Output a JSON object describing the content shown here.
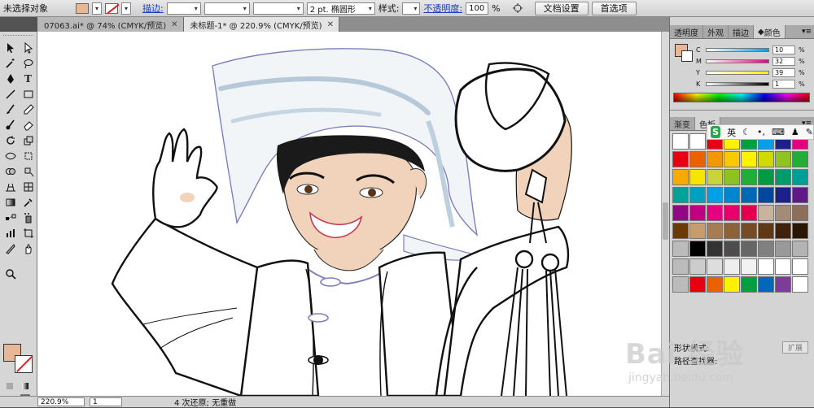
{
  "controlbar": {
    "selection_label": "未选择对象",
    "stroke_label": "描边:",
    "brush_label": "2 pt. 椭圆形",
    "style_label": "样式:",
    "opacity_label": "不透明度:",
    "opacity_value": "100",
    "opacity_unit": "%",
    "doc_setup_button": "文档设置",
    "prefs_button": "首选项"
  },
  "tabs": [
    {
      "label": "07063.ai* @ 74% (CMYK/预览)"
    },
    {
      "label": "未标题-1* @ 220.9% (CMYK/预览)"
    }
  ],
  "status": {
    "zoom": "220.9%",
    "page": "1",
    "message": "4 次还原; 无重做"
  },
  "color_panel": {
    "tabs": [
      "透明度",
      "外观",
      "描边",
      "颜色"
    ],
    "channels": [
      {
        "name": "C",
        "value": "10"
      },
      {
        "name": "M",
        "value": "32"
      },
      {
        "name": "Y",
        "value": "39"
      },
      {
        "name": "K",
        "value": "1"
      }
    ],
    "pct": "%"
  },
  "swatch_panel": {
    "tabs": [
      "渐变",
      "色板"
    ],
    "rows": [
      [
        "#ffffff",
        "#ffffff",
        "#e60012",
        "#fff100",
        "#00a040",
        "#00a0e9",
        "#1d2088",
        "#e4007f"
      ],
      [
        "#e60012",
        "#eb6100",
        "#f39800",
        "#fcc800",
        "#fff100",
        "#cfdb00",
        "#8fc31f",
        "#22ac38"
      ],
      [
        "#f6ab00",
        "#f6e500",
        "#c9d43d",
        "#8dc21f",
        "#22ac38",
        "#009944",
        "#009b6b",
        "#009e96"
      ],
      [
        "#00a29a",
        "#00a0c1",
        "#00a0e9",
        "#0086d1",
        "#0068b7",
        "#00479d",
        "#1d2088",
        "#601986"
      ],
      [
        "#920783",
        "#be0081",
        "#e4007f",
        "#e5006a",
        "#e5004f",
        "#c8b39e",
        "#a48b78",
        "#8c6e59"
      ],
      [
        "#6a3906",
        "#c69c6d",
        "#a67c52",
        "#8c6239",
        "#754c24",
        "#603813",
        "#42210b",
        "#2b1503"
      ],
      [
        "#bbbbbb",
        "#000000",
        "#333333",
        "#4d4d4d",
        "#666666",
        "#808080",
        "#999999",
        "#b3b3b3"
      ],
      [
        "#bbbbbb",
        "#cccccc",
        "#dddddd",
        "#eeeeee",
        "#f2f2f2",
        "#ffffff",
        "#ffffff",
        "#ffffff"
      ],
      [
        "#bbbbbb",
        "#e60012",
        "#eb6100",
        "#fff100",
        "#00a040",
        "#0068b7",
        "#7d3c98",
        "#ffffff"
      ]
    ]
  },
  "lower_panel": {
    "label": "形状模式:",
    "expand_button": "扩展",
    "path_label": "路径查找器:"
  },
  "ime": {
    "logo": "S",
    "lang": "英"
  },
  "watermark": {
    "brand": "Bai 经验",
    "url": "jingyan.baidu.com"
  }
}
